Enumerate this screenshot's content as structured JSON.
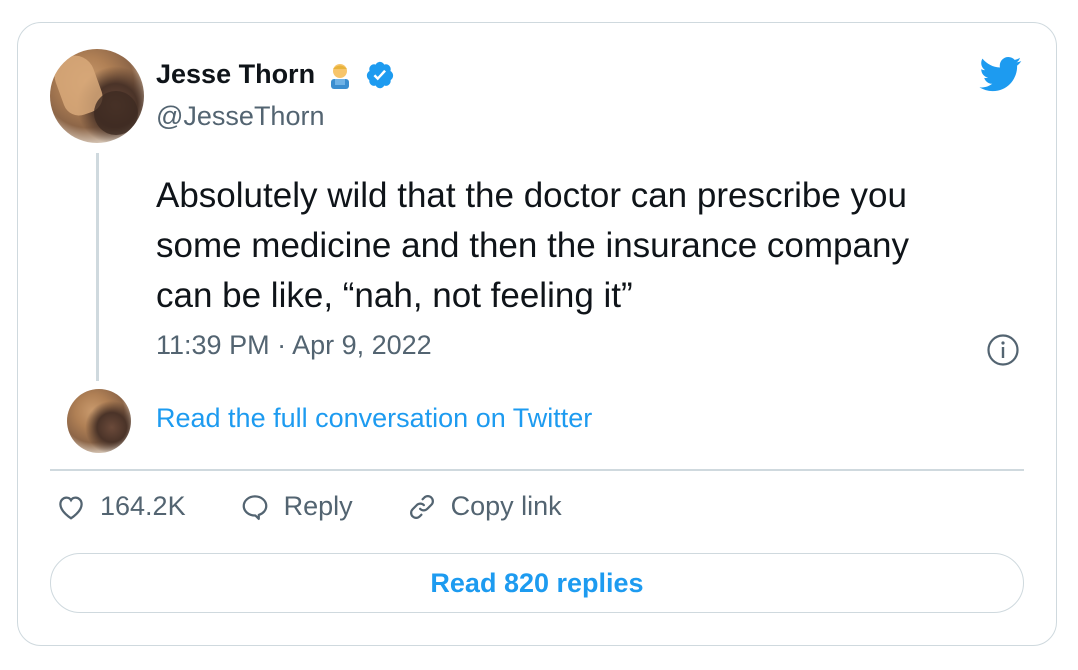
{
  "author": {
    "display_name": "Jesse Thorn",
    "handle": "@JesseThorn",
    "emoji_icon": "man-farmer-emoji",
    "verified_icon": "verified-badge-icon"
  },
  "tweet": {
    "text": "Absolutely wild that the doctor can prescribe you\nsome medicine and then the insurance company\ncan be like, “nah, not feeling it”",
    "timestamp": "11:39 PM · Apr 9, 2022"
  },
  "conversation": {
    "link_label": "Read the full conversation on Twitter"
  },
  "actions": {
    "likes_count": "164.2K",
    "reply_label": "Reply",
    "copy_link_label": "Copy link"
  },
  "footer": {
    "read_replies_label": "Read 820 replies"
  },
  "colors": {
    "twitter_blue": "#1d9bf0",
    "text_primary": "#0f1419",
    "text_secondary": "#536471",
    "border": "#cfd9de"
  }
}
